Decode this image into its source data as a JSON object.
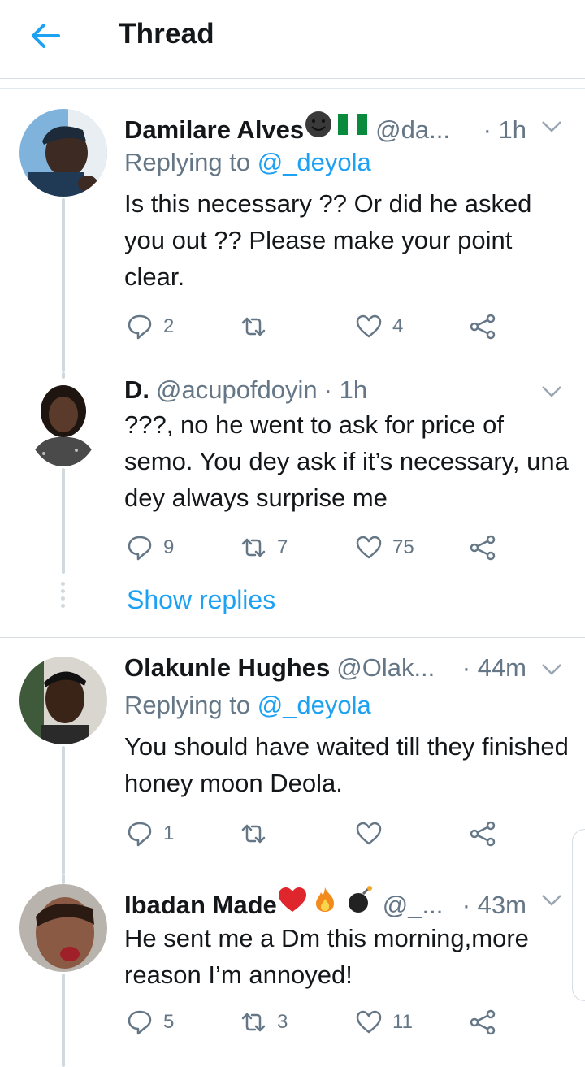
{
  "header": {
    "title": "Thread"
  },
  "tweets": [
    {
      "name": "Damilare Alves",
      "handle": "@da...",
      "time": "· 1h",
      "replying_prefix": "Replying to ",
      "replying_to": "@_deyola",
      "text": "Is this necessary ?? Or did he asked you out ?? Please make your point clear.",
      "replies": "2",
      "retweets": "",
      "likes": "4",
      "name_emojis": [
        "smiley-face-emoji",
        "nigeria-flag-emoji"
      ]
    },
    {
      "name": "D.",
      "handle": "@acupofdoyin",
      "time": "· 1h",
      "text": "???, no he went to ask for price of semo. You dey ask if it’s necessary, una dey always surprise me",
      "replies": "9",
      "retweets": "7",
      "likes": "75"
    },
    {
      "name": "Olakunle Hughes",
      "handle": "@Olak...",
      "time": "· 44m",
      "replying_prefix": "Replying to ",
      "replying_to": "@_deyola",
      "text": "You should have waited till they finished honey moon Deola.",
      "replies": "1",
      "retweets": "",
      "likes": ""
    },
    {
      "name": "Ibadan Made",
      "handle": "@_...",
      "time": "· 43m",
      "text": "He sent me a Dm this morning,more reason I’m annoyed!",
      "replies": "5",
      "retweets": "3",
      "likes": "11",
      "name_emojis": [
        "red-heart-emoji",
        "fire-emoji",
        "bomb-emoji"
      ]
    }
  ],
  "show_replies": "Show replies",
  "colors": {
    "accent": "#1da1f2",
    "secondary": "#657786",
    "text": "#14171a",
    "line": "#cfd9de"
  }
}
